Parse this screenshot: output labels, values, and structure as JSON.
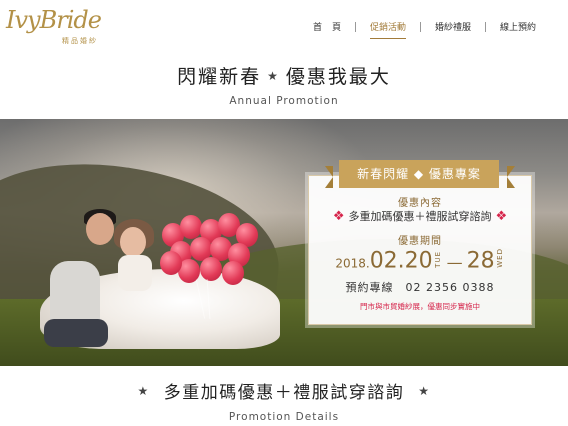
{
  "logo": {
    "script": "IvyBride",
    "sub": "精品婚紗"
  },
  "nav": {
    "items": [
      {
        "label": "首頁"
      },
      {
        "label": "促銷活動"
      },
      {
        "label": "婚紗禮服"
      },
      {
        "label": "線上預約"
      }
    ],
    "active_index": 1
  },
  "page": {
    "title_left": "閃耀新春",
    "title_right": "優惠我最大",
    "subtitle": "Annual Promotion"
  },
  "promo": {
    "banner": "新春閃耀 ◆ 優惠專案",
    "content_label": "優惠內容",
    "content": "多重加碼優惠＋禮服試穿諮詢",
    "period_label": "優惠期間",
    "year": "2018.",
    "start": "02.20",
    "start_dow": "TUE",
    "end": "28",
    "end_dow": "WED",
    "hotline": "預約專線　02 2356 0388",
    "note": "門市與市貿婚紗展，優惠同步實施中"
  },
  "details": {
    "title": "多重加碼優惠＋禮服試穿諮詢",
    "subtitle": "Promotion Details"
  },
  "icons": {
    "star": "star-icon",
    "diamond": "diamond-icon"
  },
  "colors": {
    "gold": "#c9a35b",
    "accent_text": "#8b6a35",
    "highlight": "#d6254b"
  }
}
